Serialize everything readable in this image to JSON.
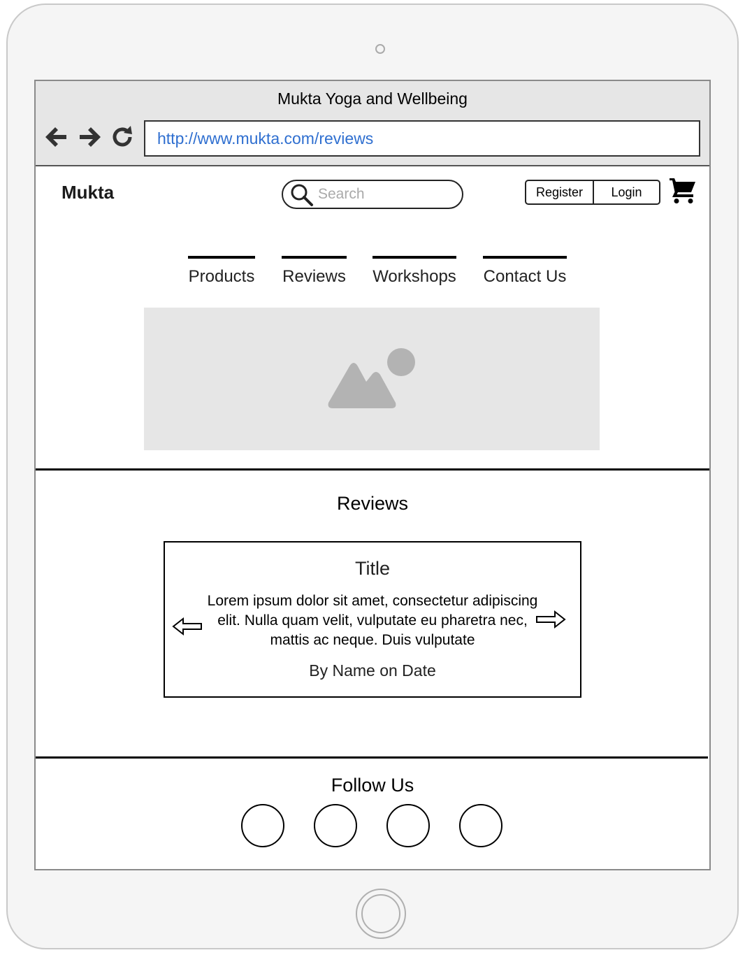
{
  "window": {
    "title": "Mukta Yoga and Wellbeing",
    "url": "http://www.mukta.com/reviews",
    "nav_icons": [
      "arrow-left-icon",
      "arrow-right-icon",
      "refresh-icon"
    ]
  },
  "header": {
    "brand": "Mukta",
    "search_placeholder": "Search",
    "register_label": "Register",
    "login_label": "Login",
    "cart_icon": "cart-icon"
  },
  "nav": {
    "tabs": [
      {
        "label": "Products"
      },
      {
        "label": "Reviews"
      },
      {
        "label": "Workshops"
      },
      {
        "label": "Contact Us"
      }
    ]
  },
  "hero": {
    "icon": "image-placeholder-icon"
  },
  "reviews": {
    "heading": "Reviews",
    "card": {
      "title": "Title",
      "text": "Lorem ipsum dolor sit amet, consectetur adipiscing elit. Nulla quam velit, vulputate eu pharetra nec, mattis ac neque. Duis vulputate",
      "byline": "By Name on Date"
    },
    "prev_icon": "arrow-left-outline-icon",
    "next_icon": "arrow-right-outline-icon"
  },
  "footer": {
    "heading": "Follow Us",
    "social_count": 4
  },
  "colors": {
    "link": "#2f6fd0",
    "placeholder_bg": "#e6e6e6",
    "placeholder_fg": "#b3b3b3",
    "device_frame": "#f5f5f5"
  }
}
